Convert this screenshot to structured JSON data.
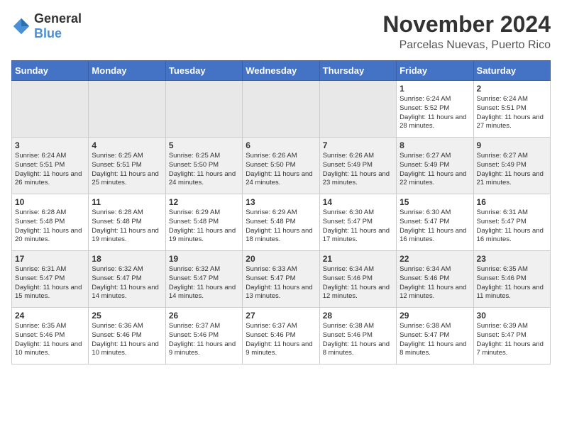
{
  "header": {
    "logo_general": "General",
    "logo_blue": "Blue",
    "month_title": "November 2024",
    "location": "Parcelas Nuevas, Puerto Rico"
  },
  "weekdays": [
    "Sunday",
    "Monday",
    "Tuesday",
    "Wednesday",
    "Thursday",
    "Friday",
    "Saturday"
  ],
  "weeks": [
    [
      {
        "day": "",
        "info": ""
      },
      {
        "day": "",
        "info": ""
      },
      {
        "day": "",
        "info": ""
      },
      {
        "day": "",
        "info": ""
      },
      {
        "day": "",
        "info": ""
      },
      {
        "day": "1",
        "info": "Sunrise: 6:24 AM\nSunset: 5:52 PM\nDaylight: 11 hours and 28 minutes."
      },
      {
        "day": "2",
        "info": "Sunrise: 6:24 AM\nSunset: 5:51 PM\nDaylight: 11 hours and 27 minutes."
      }
    ],
    [
      {
        "day": "3",
        "info": "Sunrise: 6:24 AM\nSunset: 5:51 PM\nDaylight: 11 hours and 26 minutes."
      },
      {
        "day": "4",
        "info": "Sunrise: 6:25 AM\nSunset: 5:51 PM\nDaylight: 11 hours and 25 minutes."
      },
      {
        "day": "5",
        "info": "Sunrise: 6:25 AM\nSunset: 5:50 PM\nDaylight: 11 hours and 24 minutes."
      },
      {
        "day": "6",
        "info": "Sunrise: 6:26 AM\nSunset: 5:50 PM\nDaylight: 11 hours and 24 minutes."
      },
      {
        "day": "7",
        "info": "Sunrise: 6:26 AM\nSunset: 5:49 PM\nDaylight: 11 hours and 23 minutes."
      },
      {
        "day": "8",
        "info": "Sunrise: 6:27 AM\nSunset: 5:49 PM\nDaylight: 11 hours and 22 minutes."
      },
      {
        "day": "9",
        "info": "Sunrise: 6:27 AM\nSunset: 5:49 PM\nDaylight: 11 hours and 21 minutes."
      }
    ],
    [
      {
        "day": "10",
        "info": "Sunrise: 6:28 AM\nSunset: 5:48 PM\nDaylight: 11 hours and 20 minutes."
      },
      {
        "day": "11",
        "info": "Sunrise: 6:28 AM\nSunset: 5:48 PM\nDaylight: 11 hours and 19 minutes."
      },
      {
        "day": "12",
        "info": "Sunrise: 6:29 AM\nSunset: 5:48 PM\nDaylight: 11 hours and 19 minutes."
      },
      {
        "day": "13",
        "info": "Sunrise: 6:29 AM\nSunset: 5:48 PM\nDaylight: 11 hours and 18 minutes."
      },
      {
        "day": "14",
        "info": "Sunrise: 6:30 AM\nSunset: 5:47 PM\nDaylight: 11 hours and 17 minutes."
      },
      {
        "day": "15",
        "info": "Sunrise: 6:30 AM\nSunset: 5:47 PM\nDaylight: 11 hours and 16 minutes."
      },
      {
        "day": "16",
        "info": "Sunrise: 6:31 AM\nSunset: 5:47 PM\nDaylight: 11 hours and 16 minutes."
      }
    ],
    [
      {
        "day": "17",
        "info": "Sunrise: 6:31 AM\nSunset: 5:47 PM\nDaylight: 11 hours and 15 minutes."
      },
      {
        "day": "18",
        "info": "Sunrise: 6:32 AM\nSunset: 5:47 PM\nDaylight: 11 hours and 14 minutes."
      },
      {
        "day": "19",
        "info": "Sunrise: 6:32 AM\nSunset: 5:47 PM\nDaylight: 11 hours and 14 minutes."
      },
      {
        "day": "20",
        "info": "Sunrise: 6:33 AM\nSunset: 5:47 PM\nDaylight: 11 hours and 13 minutes."
      },
      {
        "day": "21",
        "info": "Sunrise: 6:34 AM\nSunset: 5:46 PM\nDaylight: 11 hours and 12 minutes."
      },
      {
        "day": "22",
        "info": "Sunrise: 6:34 AM\nSunset: 5:46 PM\nDaylight: 11 hours and 12 minutes."
      },
      {
        "day": "23",
        "info": "Sunrise: 6:35 AM\nSunset: 5:46 PM\nDaylight: 11 hours and 11 minutes."
      }
    ],
    [
      {
        "day": "24",
        "info": "Sunrise: 6:35 AM\nSunset: 5:46 PM\nDaylight: 11 hours and 10 minutes."
      },
      {
        "day": "25",
        "info": "Sunrise: 6:36 AM\nSunset: 5:46 PM\nDaylight: 11 hours and 10 minutes."
      },
      {
        "day": "26",
        "info": "Sunrise: 6:37 AM\nSunset: 5:46 PM\nDaylight: 11 hours and 9 minutes."
      },
      {
        "day": "27",
        "info": "Sunrise: 6:37 AM\nSunset: 5:46 PM\nDaylight: 11 hours and 9 minutes."
      },
      {
        "day": "28",
        "info": "Sunrise: 6:38 AM\nSunset: 5:46 PM\nDaylight: 11 hours and 8 minutes."
      },
      {
        "day": "29",
        "info": "Sunrise: 6:38 AM\nSunset: 5:47 PM\nDaylight: 11 hours and 8 minutes."
      },
      {
        "day": "30",
        "info": "Sunrise: 6:39 AM\nSunset: 5:47 PM\nDaylight: 11 hours and 7 minutes."
      }
    ]
  ]
}
